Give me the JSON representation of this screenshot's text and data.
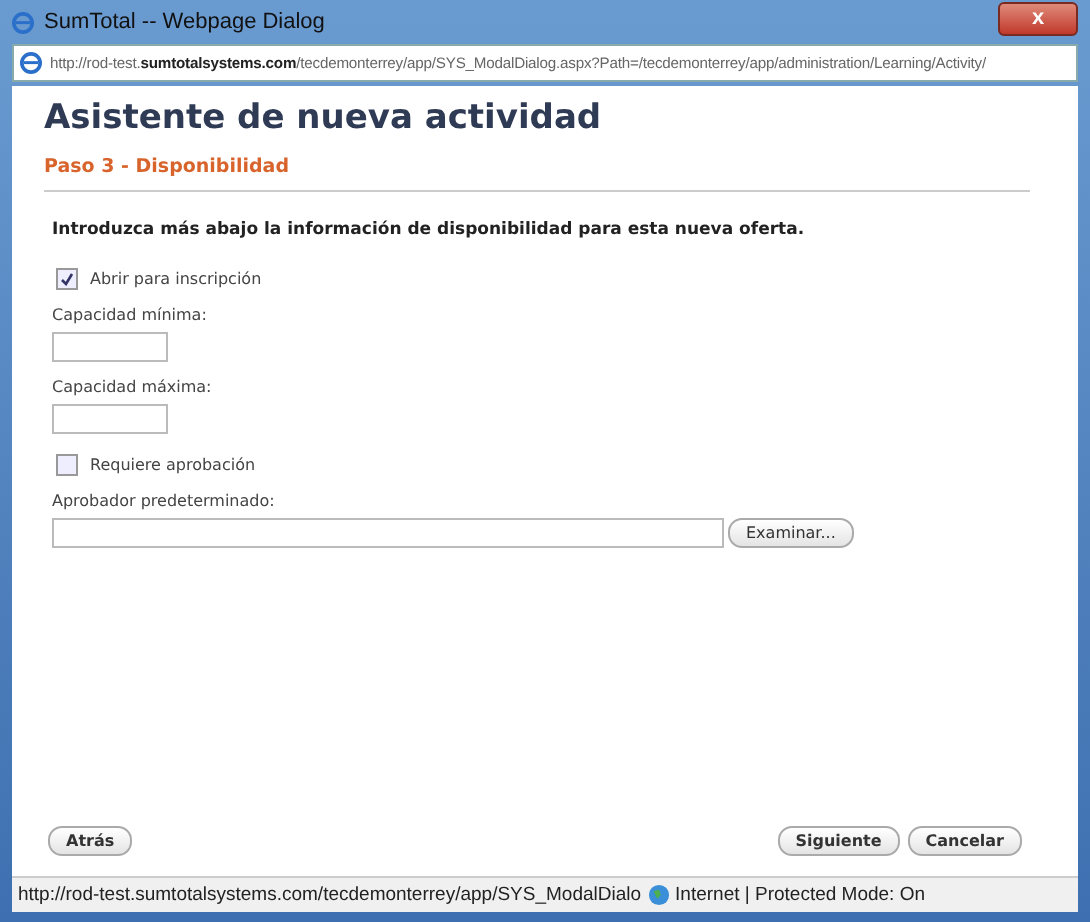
{
  "window": {
    "title": "SumTotal -- Webpage Dialog",
    "close": "x"
  },
  "address_bar": {
    "url": "http://rod-test.**sumtotalsystems.com**/tecdemonterrey/app/SYS_ModalDialog.aspx?Path=/tecdemonterrey/app/administration/Learning/Activity/"
  },
  "page": {
    "title": "Asistente de nueva actividad",
    "step": "Paso 3 - Disponibilidad",
    "intro": "Introduzca más abajo la información de disponibilidad para esta nueva oferta."
  },
  "form": [
    {
      "kind": "checkbox",
      "label": "Abrir para inscripción",
      "checked": true
    },
    {
      "kind": "field",
      "label": "Capacidad mínima:"
    },
    {
      "kind": "field",
      "label": "Capacidad máxima:"
    },
    {
      "kind": "checkbox",
      "label": "Requiere aprobación",
      "checked": false
    },
    {
      "kind": "lookup",
      "label": "Aprobador predeterminado:",
      "button": "Examinar..."
    }
  ],
  "buttons": {
    "back": "Atrás",
    "next": "Siguiente",
    "cancel": "Cancelar"
  },
  "status_bar": {
    "url": "http://rod-test.sumtotalsystems.com/tecdemonterrey/app/SYS_ModalDialo",
    "zone": "Internet | Protected Mode: On"
  }
}
